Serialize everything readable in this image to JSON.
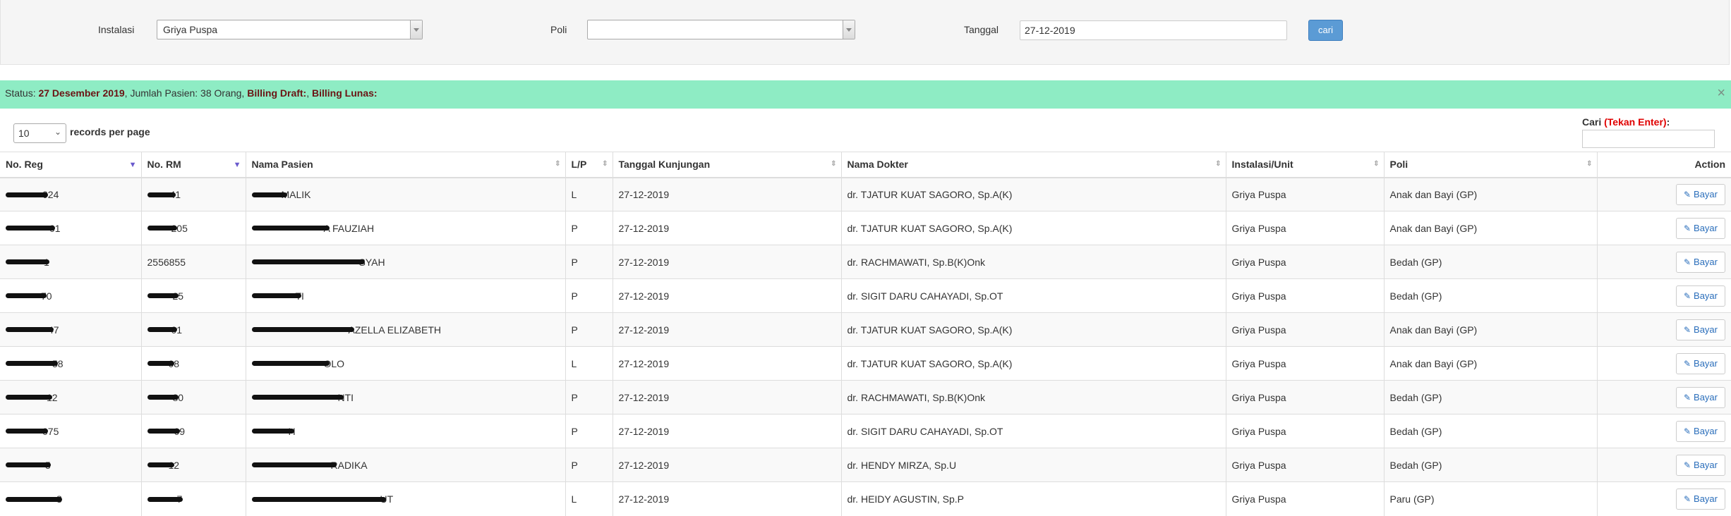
{
  "filter": {
    "instalasi_label": "Instalasi",
    "instalasi_value": "Griya Puspa",
    "poli_label": "Poli",
    "poli_value": "",
    "tanggal_label": "Tanggal",
    "tanggal_value": "27-12-2019",
    "search_button": "cari"
  },
  "status": {
    "prefix": "Status: ",
    "date": "27 Desember 2019",
    "patients": ", Jumlah Pasien: 38 Orang, ",
    "draft_label": "Billing Draft:",
    "separator": ", ",
    "lunas_label": "Billing Lunas:",
    "close": "×"
  },
  "length": {
    "value": "10",
    "label": "records per page"
  },
  "search": {
    "label": "Cari ",
    "hint": "(Tekan Enter)",
    "colon": ":"
  },
  "table": {
    "columns": [
      "No. Reg",
      "No. RM",
      "Nama Pasien",
      "L/P",
      "Tanggal Kunjungan",
      "Nama Dokter",
      "Instalasi/Unit",
      "Poli",
      "Action"
    ],
    "action_label": "Bayar",
    "rows": [
      {
        "no_reg": "024",
        "no_rm": "41",
        "nama": "MALIK",
        "lp": "L",
        "tanggal": "27-12-2019",
        "dokter": "dr. TJATUR KUAT SAGORO, Sp.A(K)",
        "instalasi": "Griya Puspa",
        "poli": "Anak dan Bayi (GP)"
      },
      {
        "no_reg": "01",
        "no_rm": "205",
        "nama": "A FAUZIAH",
        "lp": "P",
        "tanggal": "27-12-2019",
        "dokter": "dr. TJATUR KUAT SAGORO, Sp.A(K)",
        "instalasi": "Griya Puspa",
        "poli": "Anak dan Bayi (GP)"
      },
      {
        "no_reg": "1",
        "no_rm": "2556855",
        "nama": "SYAH",
        "lp": "P",
        "tanggal": "27-12-2019",
        "dokter": "dr. RACHMAWATI, Sp.B(K)Onk",
        "instalasi": "Griya Puspa",
        "poli": "Bedah (GP)"
      },
      {
        "no_reg": "70",
        "no_rm": "25",
        "nama": "TI",
        "lp": "P",
        "tanggal": "27-12-2019",
        "dokter": "dr. SIGIT DARU CAHAYADI, Sp.OT",
        "instalasi": "Griya Puspa",
        "poli": "Bedah (GP)"
      },
      {
        "no_reg": "47",
        "no_rm": "01",
        "nama": "AZELLA ELIZABETH",
        "lp": "P",
        "tanggal": "27-12-2019",
        "dokter": "dr. TJATUR KUAT SAGORO, Sp.A(K)",
        "instalasi": "Griya Puspa",
        "poli": "Anak dan Bayi (GP)"
      },
      {
        "no_reg": "58",
        "no_rm": "08",
        "nama": "OLO",
        "lp": "L",
        "tanggal": "27-12-2019",
        "dokter": "dr. TJATUR KUAT SAGORO, Sp.A(K)",
        "instalasi": "Griya Puspa",
        "poli": "Anak dan Bayi (GP)"
      },
      {
        "no_reg": "12",
        "no_rm": "80",
        "nama": "NTI",
        "lp": "P",
        "tanggal": "27-12-2019",
        "dokter": "dr. RACHMAWATI, Sp.B(K)Onk",
        "instalasi": "Griya Puspa",
        "poli": "Bedah (GP)"
      },
      {
        "no_reg": "075",
        "no_rm": "09",
        "nama": "H",
        "lp": "P",
        "tanggal": "27-12-2019",
        "dokter": "dr. SIGIT DARU CAHAYADI, Sp.OT",
        "instalasi": "Griya Puspa",
        "poli": "Bedah (GP)"
      },
      {
        "no_reg": "5",
        "no_rm": "12",
        "nama": "RADIKA",
        "lp": "P",
        "tanggal": "27-12-2019",
        "dokter": "dr. HENDY MIRZA, Sp.U",
        "instalasi": "Griya Puspa",
        "poli": "Bedah (GP)"
      },
      {
        "no_reg": "8",
        "no_rm": "7",
        "nama": "UT",
        "lp": "L",
        "tanggal": "27-12-2019",
        "dokter": "dr. HEIDY AGUSTIN, Sp.P",
        "instalasi": "Griya Puspa",
        "poli": "Paru (GP)"
      }
    ]
  },
  "colors": {
    "status_bg": "#8eecc4",
    "button_primary": "#5b9bd5",
    "emphasis": "#6b1414",
    "hint_red": "#e00000",
    "link_blue": "#2a6ebb"
  }
}
